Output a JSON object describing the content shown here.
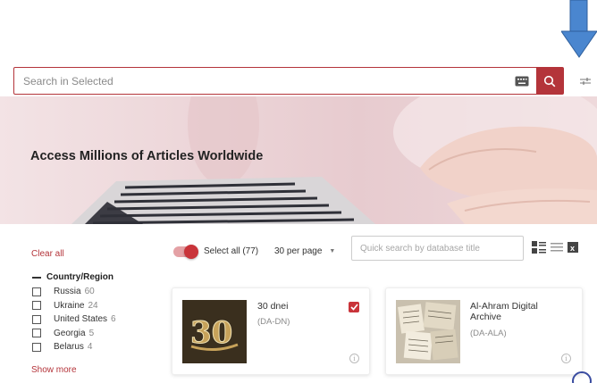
{
  "search": {
    "placeholder": "Search in Selected"
  },
  "hero": {
    "title": "Access Millions of Articles Worldwide"
  },
  "filters": {
    "clear_all": "Clear all",
    "group_title": "Country/Region",
    "items": [
      {
        "label": "Russia",
        "count": "60"
      },
      {
        "label": "Ukraine",
        "count": "24"
      },
      {
        "label": "United States",
        "count": "6"
      },
      {
        "label": "Georgia",
        "count": "5"
      },
      {
        "label": "Belarus",
        "count": "4"
      }
    ],
    "show_more": "Show more"
  },
  "toolbar": {
    "select_all": "Select all (77)",
    "per_page": "30 per page",
    "quick_search_placeholder": "Quick search by database title"
  },
  "cards": [
    {
      "title": "30 dnei",
      "code": "(DA-DN)",
      "checked": true,
      "thumb_text": "30"
    },
    {
      "title": "Al-Ahram Digital Archive",
      "code": "(DA-ALA)",
      "checked": false
    }
  ],
  "colors": {
    "accent": "#b4343a",
    "arrow": "#4a86cf"
  }
}
